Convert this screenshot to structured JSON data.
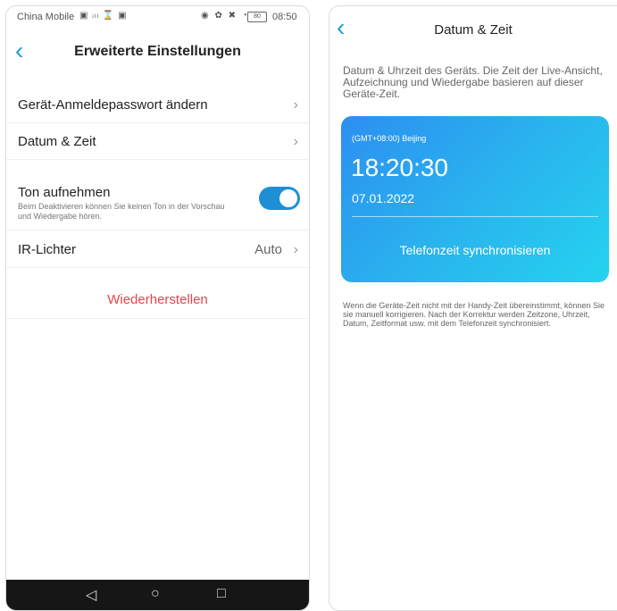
{
  "left": {
    "status": {
      "carrier": "China Mobile",
      "left_icons": "▣ ᵢₗₗ ⌛ ▣",
      "right_icons": "◉ ✿ ✖ ◔",
      "battery": "80",
      "time": "08:50"
    },
    "header": {
      "back_icon": "chevron-left-icon",
      "title": "Erweiterte Einstellungen"
    },
    "rows": {
      "password": "Gerät-Anmeldepasswort ändern",
      "datetime": "Datum & Zeit",
      "sound_label": "Ton aufnehmen",
      "sound_desc": "Beim Deaktivieren können Sie keinen Ton in der Vorschau und Wiedergabe hören.",
      "sound_on": true,
      "ir_label": "IR-Lichter",
      "ir_value": "Auto"
    },
    "restore": "Wiederherstellen",
    "navbar": {
      "back": "◁",
      "home": "○",
      "recent": "□"
    }
  },
  "right": {
    "header": {
      "back_icon": "chevron-left-icon",
      "title": "Datum & Zeit"
    },
    "info": "Datum & Uhrzeit des Geräts. Die Zeit der Live-Ansicht, Aufzeichnung und Wiedergabe basieren auf dieser Geräte-Zeit.",
    "card": {
      "timezone": "(GMT+08:00) Beijing",
      "time": "18:20:30",
      "date": "07.01.2022",
      "sync": "Telefonzeit synchronisieren"
    },
    "note": "Wenn die Geräte-Zeit nicht mit der Handy-Zeit übereinstimmt, können Sie sie manuell korrigieren. Nach der Korrektur werden Zeitzone, Uhrzeit, Datum, Zeitformat usw. mit dem Telefonzeit synchronisiert."
  },
  "colors": {
    "accent": "#1e9bd7",
    "toggle": "#1e8fd5",
    "danger": "#e0474c"
  }
}
